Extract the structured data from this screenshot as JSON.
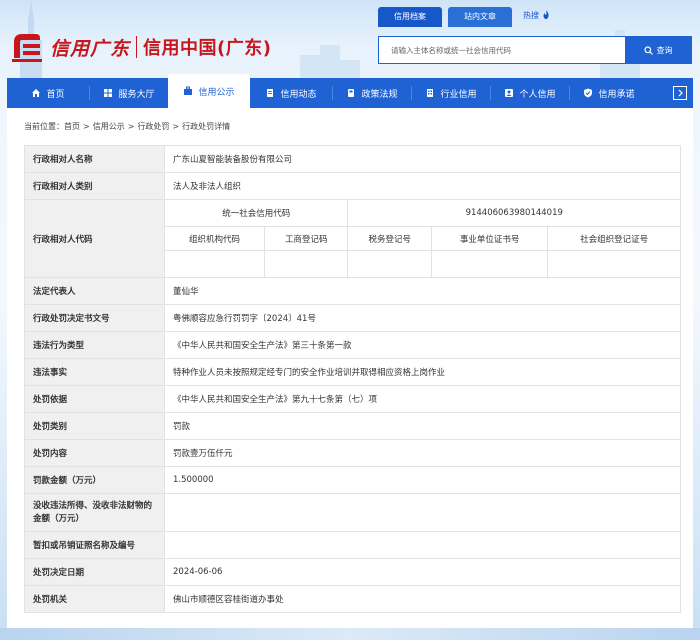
{
  "header": {
    "logo_brush": "信用广东",
    "logo_text": "信用中国(广东)",
    "search_tabs": [
      "信用档案",
      "站内文章"
    ],
    "hot_label": "热搜",
    "search_placeholder": "请输入主体名称或统一社会信用代码",
    "search_button": "查询"
  },
  "nav": {
    "items": [
      {
        "label": "首页",
        "icon": "home-icon"
      },
      {
        "label": "服务大厅",
        "icon": "grid-icon"
      },
      {
        "label": "信用公示",
        "icon": "briefcase-icon",
        "active": true
      },
      {
        "label": "信用动态",
        "icon": "document-icon"
      },
      {
        "label": "政策法规",
        "icon": "book-icon"
      },
      {
        "label": "行业信用",
        "icon": "building-icon"
      },
      {
        "label": "个人信用",
        "icon": "person-icon"
      },
      {
        "label": "信用承诺",
        "icon": "shield-check-icon"
      }
    ]
  },
  "breadcrumb": {
    "prefix": "当前位置：",
    "items": [
      "首页",
      "信用公示",
      "行政处罚",
      "行政处罚详情"
    ]
  },
  "detail": {
    "name_label": "行政相对人名称",
    "name_value": "广东山夏智能装备股份有限公司",
    "category_label": "行政相对人类别",
    "category_value": "法人及非法人组织",
    "code_label": "行政相对人代码",
    "uscc_label": "统一社会信用代码",
    "uscc_value": "914406063980144019",
    "code_headers": [
      "组织机构代码",
      "工商登记码",
      "税务登记号",
      "事业单位证书号",
      "社会组织登记证号"
    ],
    "rep_label": "法定代表人",
    "rep_value": "董仙华",
    "doc_label": "行政处罚决定书文号",
    "doc_value": "粤佛顺容应急行罚罚字〔2024〕41号",
    "type_label": "违法行为类型",
    "type_value": "《中华人民共和国安全生产法》第三十条第一款",
    "fact_label": "违法事实",
    "fact_value": "特种作业人员未按照规定经专门的安全作业培训并取得相应资格上岗作业",
    "basis_label": "处罚依据",
    "basis_value": "《中华人民共和国安全生产法》第九十七条第（七）项",
    "ptype_label": "处罚类别",
    "ptype_value": "罚款",
    "content_label": "处罚内容",
    "content_value": "罚款壹万伍仟元",
    "amount_label": "罚款金额（万元）",
    "amount_value": "1.500000",
    "confiscate_label": "没收违法所得、没收非法财物的金额（万元）",
    "confiscate_value": "",
    "license_label": "暂扣或吊销证照名称及编号",
    "license_value": "",
    "date_label": "处罚决定日期",
    "date_value": "2024-06-06",
    "authority_label": "处罚机关",
    "authority_value": "佛山市顺德区容桂街道办事处"
  }
}
